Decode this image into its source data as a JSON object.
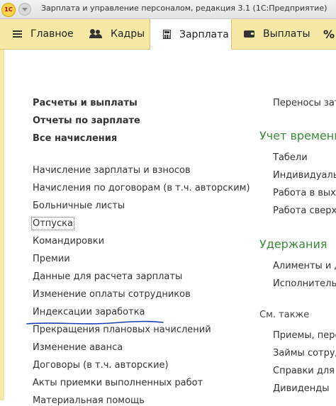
{
  "window": {
    "logo_text": "1С",
    "title": "Зарплата и управление персоналом, редакция 3.1  (1С:Предприятие)"
  },
  "nav": {
    "items": [
      {
        "label": "Главное"
      },
      {
        "label": "Кадры"
      },
      {
        "label": "Зарплата"
      },
      {
        "label": "Выплаты"
      },
      {
        "label": "%"
      }
    ],
    "active_index": 2
  },
  "left_column": {
    "bold_links": [
      "Расчеты и выплаты",
      "Отчеты по зарплате",
      "Все начисления"
    ],
    "links": [
      "Начисление зарплаты и взносов",
      "Начисления по договорам (в т.ч. авторским)",
      "Больничные листы",
      "Отпуска",
      "Командировки",
      "Премии",
      "Данные для расчета зарплаты",
      "Изменение оплаты сотрудников",
      "Индексации заработка",
      "Прекращения плановых начислений",
      "Изменение аванса",
      "Договоры (в т.ч. авторские)",
      "Акты приемки выполненных работ",
      "Материальная помощь"
    ]
  },
  "right_column": {
    "top_link": "Переносы затр",
    "sections": [
      {
        "title": "Учет времени",
        "links": [
          "Табели",
          "Индивидуальн",
          "Работа в выхо",
          "Работа сверху"
        ]
      },
      {
        "title": "Удержания",
        "links": [
          "Алименты и др",
          "Исполнительн"
        ]
      }
    ],
    "see_also_title": "См. также",
    "see_also_links": [
      "Приемы, перев",
      "Займы сотруд",
      "Справки для р",
      "Дивиденды"
    ]
  },
  "colors": {
    "nav_bg": "#f6e9a6",
    "section_title": "#3a8a3a",
    "annotation_underline": "#1a3fb0"
  }
}
